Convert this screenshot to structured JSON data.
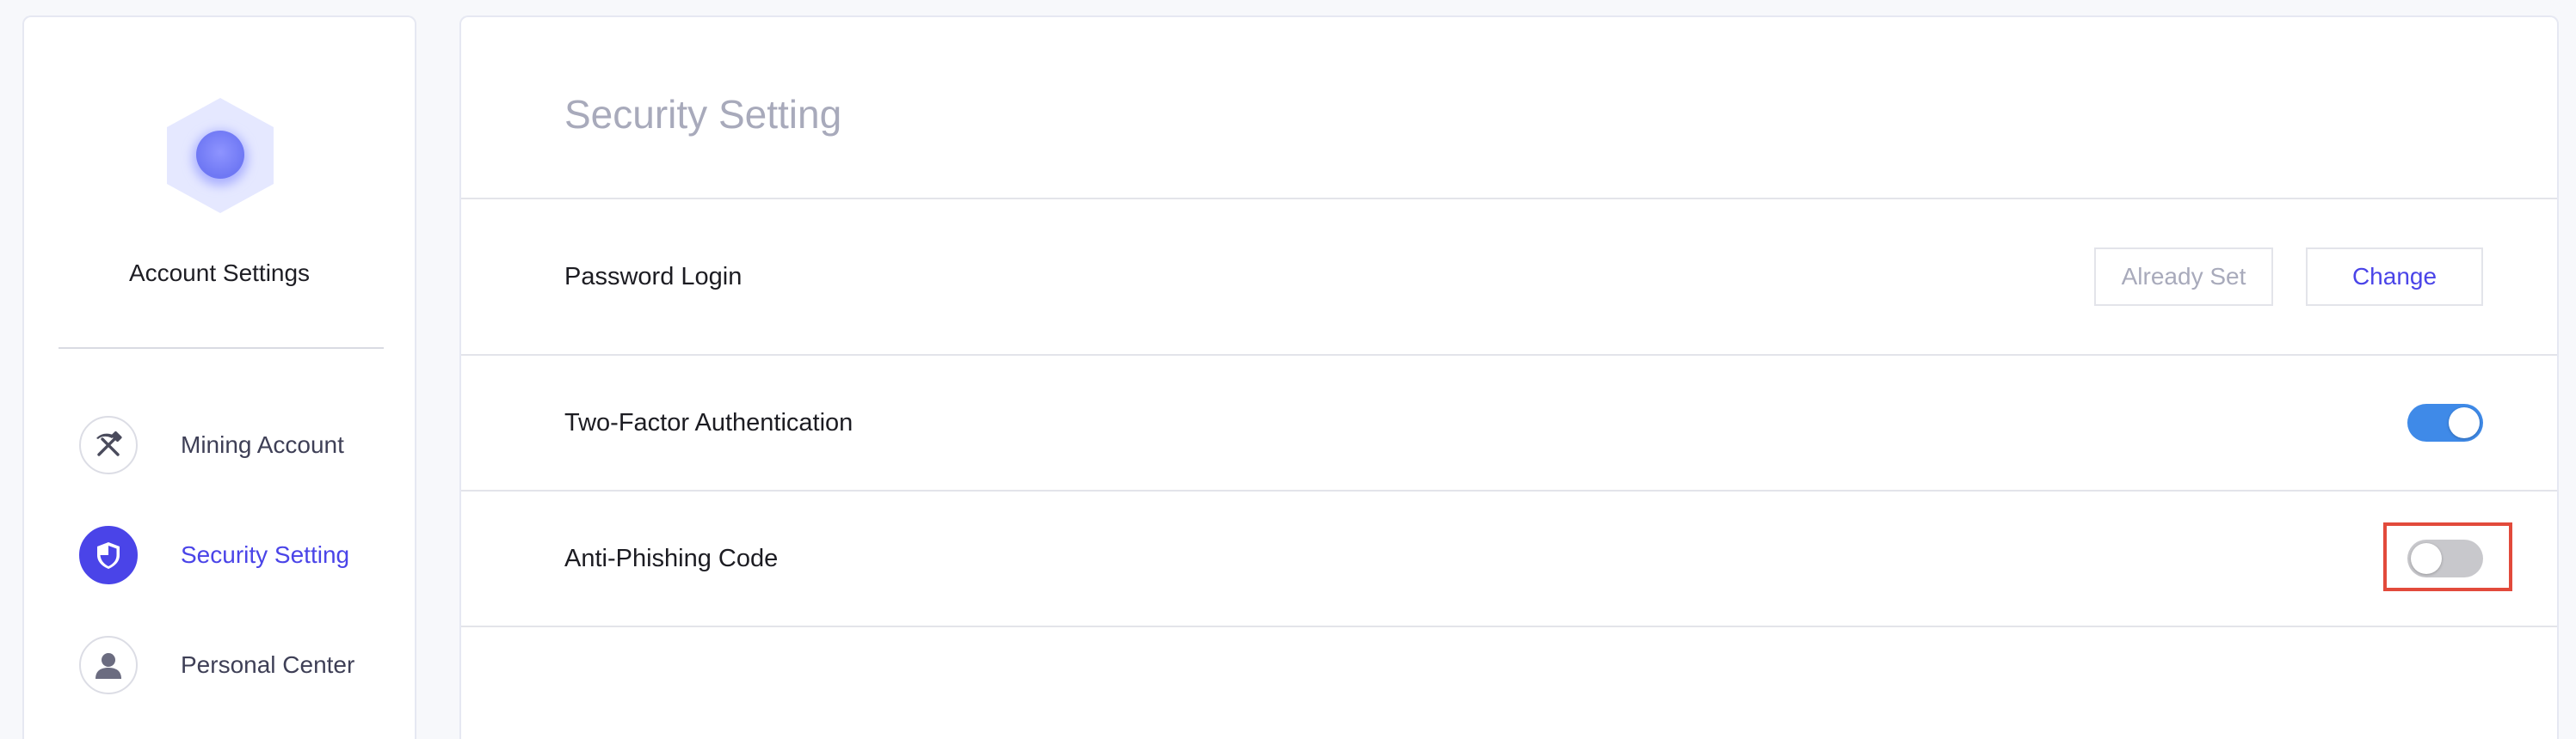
{
  "sidebar": {
    "title": "Account Settings",
    "items": [
      {
        "label": "Mining Account",
        "icon": "pickaxe-hammer-icon",
        "active": false
      },
      {
        "label": "Security Setting",
        "icon": "shield-icon",
        "active": true
      },
      {
        "label": "Personal Center",
        "icon": "user-icon",
        "active": false
      }
    ]
  },
  "main": {
    "title": "Security Setting",
    "rows": {
      "password": {
        "label": "Password Login",
        "status_label": "Already Set",
        "change_label": "Change"
      },
      "two_factor": {
        "label": "Two-Factor Authentication",
        "enabled": true
      },
      "anti_phishing": {
        "label": "Anti-Phishing Code",
        "enabled": false
      }
    }
  },
  "colors": {
    "accent": "#4a44e8",
    "toggle_on": "#3f8ae8",
    "toggle_off": "#c8c8cc",
    "highlight": "#e24a3b",
    "title_muted": "#a8aabb"
  }
}
